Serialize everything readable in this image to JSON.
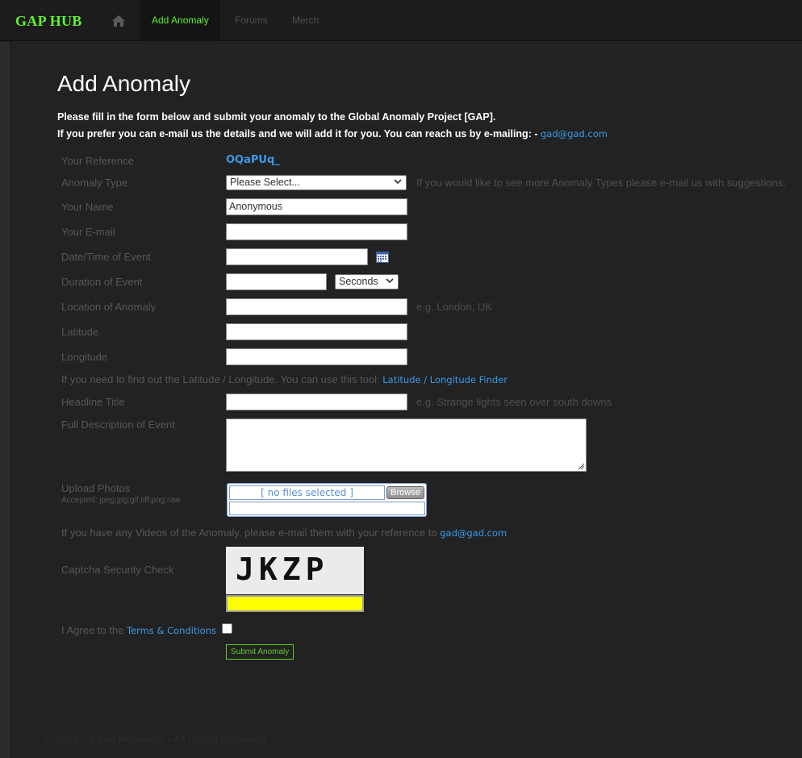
{
  "nav": {
    "brand": "GAP HUB",
    "tabs": [
      "Add Anomaly",
      "Forums",
      "Merch"
    ]
  },
  "page": {
    "title": "Add Anomaly",
    "intro1": "Please fill in the form below and submit your anomaly to the Global Anomaly Project [GAP].",
    "intro2": "If you prefer you can e-mail us the details and we will add it for you. You can reach us by e-mailing: -",
    "email": "gad@gad.com"
  },
  "form": {
    "reference_label": "Your Reference",
    "reference_value": "OQaPUq_",
    "anomaly_type_label": "Anomaly Type",
    "anomaly_type_value": "Please Select...",
    "anomaly_type_hint": "If you would like to see more Anomaly Types please e-mail us with suggestions.",
    "name_label": "Your Name",
    "name_value": "Anonymous",
    "email_label": "Your E-mail",
    "datetime_label": "Date/Time of Event",
    "duration_label": "Duration of Event",
    "duration_unit": "Seconds",
    "location_label": "Location of Anomaly",
    "location_hint": "e.g. London, UK",
    "latitude_label": "Latitude",
    "longitude_label": "Longitude",
    "latlong_note": "If you need to find out the Latitude / Longitude. You can use this tool:",
    "latlong_link": "Latitude / Longitude Finder",
    "headline_label": "Headline Title",
    "headline_hint": "e.g. Strange lights seen over south downs",
    "description_label": "Full Description of Event",
    "upload_label": "Upload Photos",
    "upload_accepted": "Accepted: jpeg;jpg;gif;tiff;png;raw",
    "upload_files": "[ no files selected ]",
    "upload_browse": "Browse",
    "videos_note": "If you have any Videos of the Anomaly, please e-mail them with your reference to",
    "videos_email": "gad@gad.com",
    "captcha_label": "Captcha Security Check",
    "captcha_text": "JKZP",
    "agree_label": "I Agree to the",
    "terms_link": "Terms & Conditions",
    "submit_label": "Submit Anomaly"
  },
  "footer": {
    "text": "© 2022 - Julian Mummery - All Rights Reserved"
  },
  "colors": {
    "brand": "#5ef22f",
    "link": "#3a9ae8",
    "captcha_field": "#ffff00"
  }
}
